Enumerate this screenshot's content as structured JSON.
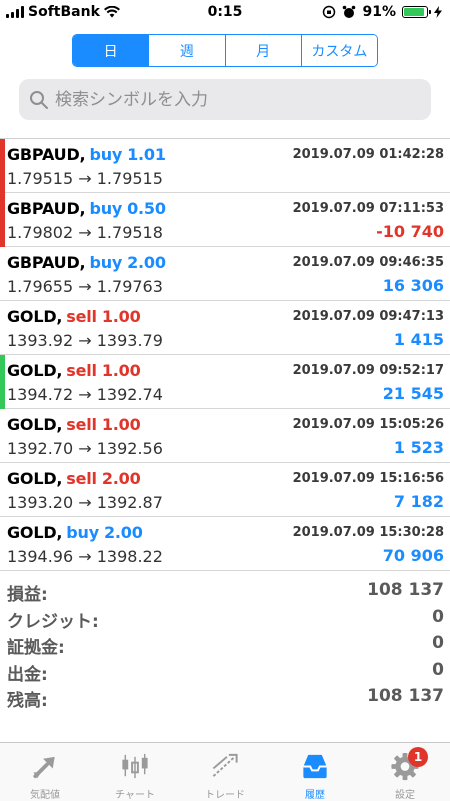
{
  "status": {
    "carrier": "SoftBank",
    "time": "0:15",
    "battery": "91%"
  },
  "periods": {
    "tabs": [
      "日",
      "週",
      "月",
      "カスタム"
    ],
    "active_index": 0
  },
  "search": {
    "placeholder": "検索シンボルを入力"
  },
  "trades": [
    {
      "symbol": "GBPAUD,",
      "op": "buy",
      "volume": "1.01",
      "time": "2019.07.09 01:42:28",
      "prices": "1.79515 → 1.79515",
      "profit": "",
      "marker": "#e0352b"
    },
    {
      "symbol": "GBPAUD,",
      "op": "buy",
      "volume": "0.50",
      "time": "2019.07.09 07:11:53",
      "prices": "1.79802 → 1.79518",
      "profit": "-10 740",
      "marker": "#e0352b"
    },
    {
      "symbol": "GBPAUD,",
      "op": "buy",
      "volume": "2.00",
      "time": "2019.07.09 09:46:35",
      "prices": "1.79655 → 1.79763",
      "profit": "16 306",
      "marker": ""
    },
    {
      "symbol": "GOLD,",
      "op": "sell",
      "volume": "1.00",
      "time": "2019.07.09 09:47:13",
      "prices": "1393.92 → 1393.79",
      "profit": "1 415",
      "marker": ""
    },
    {
      "symbol": "GOLD,",
      "op": "sell",
      "volume": "1.00",
      "time": "2019.07.09 09:52:17",
      "prices": "1394.72 → 1392.74",
      "profit": "21 545",
      "marker": "#34c759"
    },
    {
      "symbol": "GOLD,",
      "op": "sell",
      "volume": "1.00",
      "time": "2019.07.09 15:05:26",
      "prices": "1392.70 → 1392.56",
      "profit": "1 523",
      "marker": ""
    },
    {
      "symbol": "GOLD,",
      "op": "sell",
      "volume": "2.00",
      "time": "2019.07.09 15:16:56",
      "prices": "1393.20 → 1392.87",
      "profit": "7 182",
      "marker": ""
    },
    {
      "symbol": "GOLD,",
      "op": "buy",
      "volume": "2.00",
      "time": "2019.07.09 15:30:28",
      "prices": "1394.96 → 1398.22",
      "profit": "70 906",
      "marker": ""
    }
  ],
  "summary": [
    {
      "label": "損益:",
      "value": "108 137"
    },
    {
      "label": "クレジット:",
      "value": "0"
    },
    {
      "label": "証拠金:",
      "value": "0"
    },
    {
      "label": "出金:",
      "value": "0"
    },
    {
      "label": "残高:",
      "value": "108 137"
    }
  ],
  "tabbar": {
    "tabs": [
      {
        "label": "気配値",
        "icon": "quotes-icon"
      },
      {
        "label": "チャート",
        "icon": "chart-icon"
      },
      {
        "label": "トレード",
        "icon": "trade-icon"
      },
      {
        "label": "履歴",
        "icon": "history-icon"
      },
      {
        "label": "設定",
        "icon": "settings-icon"
      }
    ],
    "active_index": 3,
    "settings_badge": "1"
  },
  "colors": {
    "accent": "#1a8cff",
    "sell": "#e0352b",
    "loss": "#e0352b"
  }
}
